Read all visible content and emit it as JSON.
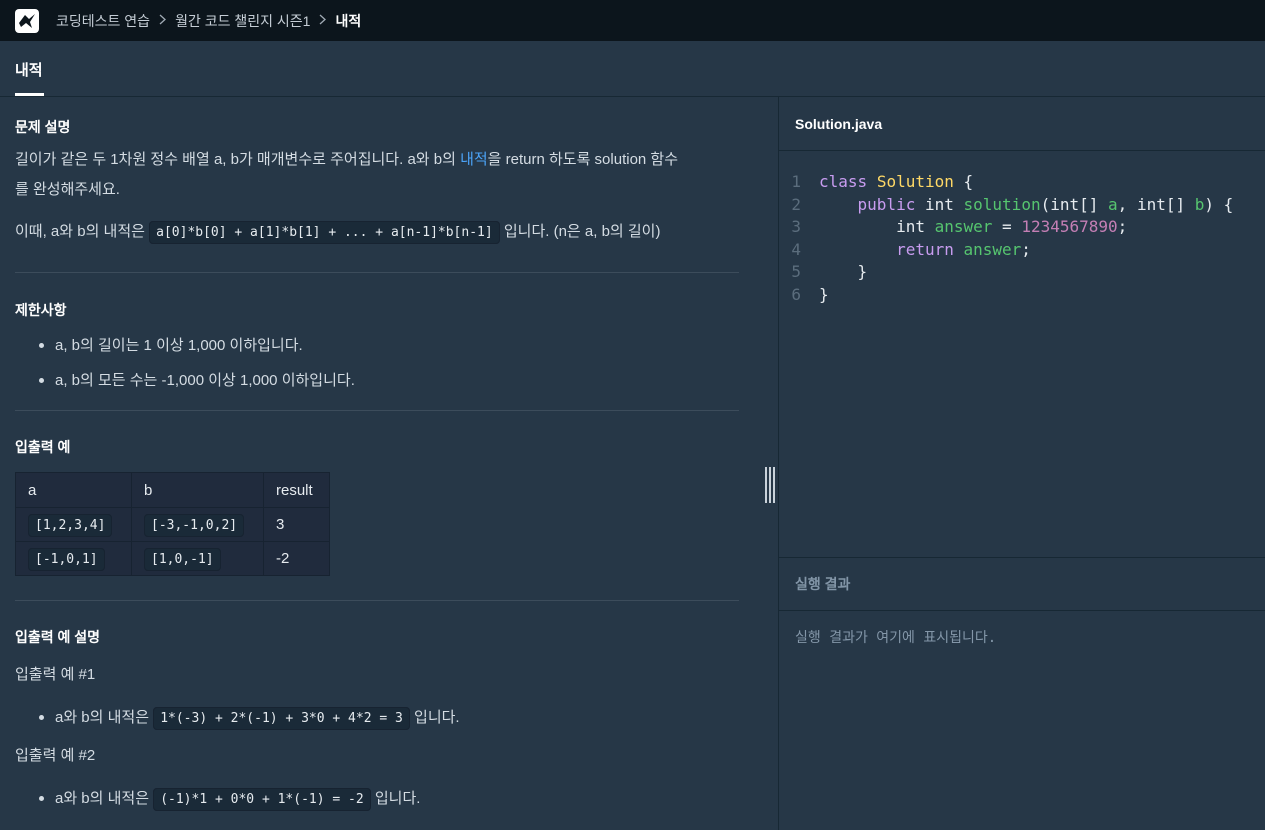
{
  "breadcrumb": {
    "items": [
      "코딩테스트 연습",
      "월간 코드 챌린지 시즌1",
      "내적"
    ]
  },
  "tab": {
    "label": "내적"
  },
  "problem": {
    "desc_heading": "문제 설명",
    "desc_part1": "길이가 같은 두 1차원 정수 배열 a, b가 매개변수로 주어집니다. a와 b의 ",
    "desc_highlight": "내적",
    "desc_part2": "을 return 하도록 solution 함수",
    "desc_line2": "를 완성해주세요.",
    "desc_formula_pre": "이때, a와 b의 내적은",
    "desc_formula": "a[0]*b[0] + a[1]*b[1] + ... + a[n-1]*b[n-1]",
    "desc_formula_post": "입니다. (n은 a, b의 길이)",
    "constraints_heading": "제한사항",
    "constraints": [
      "a, b의 길이는 1 이상 1,000 이하입니다.",
      "a, b의 모든 수는 -1,000 이상 1,000 이하입니다."
    ],
    "io_heading": "입출력 예",
    "io_table": {
      "headers": [
        "a",
        "b",
        "result"
      ],
      "rows": [
        [
          "[1,2,3,4]",
          "[-3,-1,0,2]",
          "3"
        ],
        [
          "[-1,0,1]",
          "[1,0,-1]",
          "-2"
        ]
      ]
    },
    "explain_heading": "입출력 예 설명",
    "ex1_title": "입출력 예 #1",
    "ex1_pre": "a와 b의 내적은",
    "ex1_code": "1*(-3) + 2*(-1) + 3*0 + 4*2 = 3",
    "ex1_post": "입니다.",
    "ex2_title": "입출력 예 #2",
    "ex2_pre": "a와 b의 내적은",
    "ex2_code": "(-1)*1 + 0*0 + 1*(-1) = -2",
    "ex2_post": "입니다."
  },
  "editor": {
    "filename": "Solution.java",
    "line_numbers": [
      "1",
      "2",
      "3",
      "4",
      "5",
      "6"
    ]
  },
  "result": {
    "heading": "실행 결과",
    "placeholder": "실행 결과가 여기에 표시됩니다."
  },
  "colors": {
    "background": "#263747",
    "topbar": "#0c151c",
    "link": "#4ba3f7"
  }
}
